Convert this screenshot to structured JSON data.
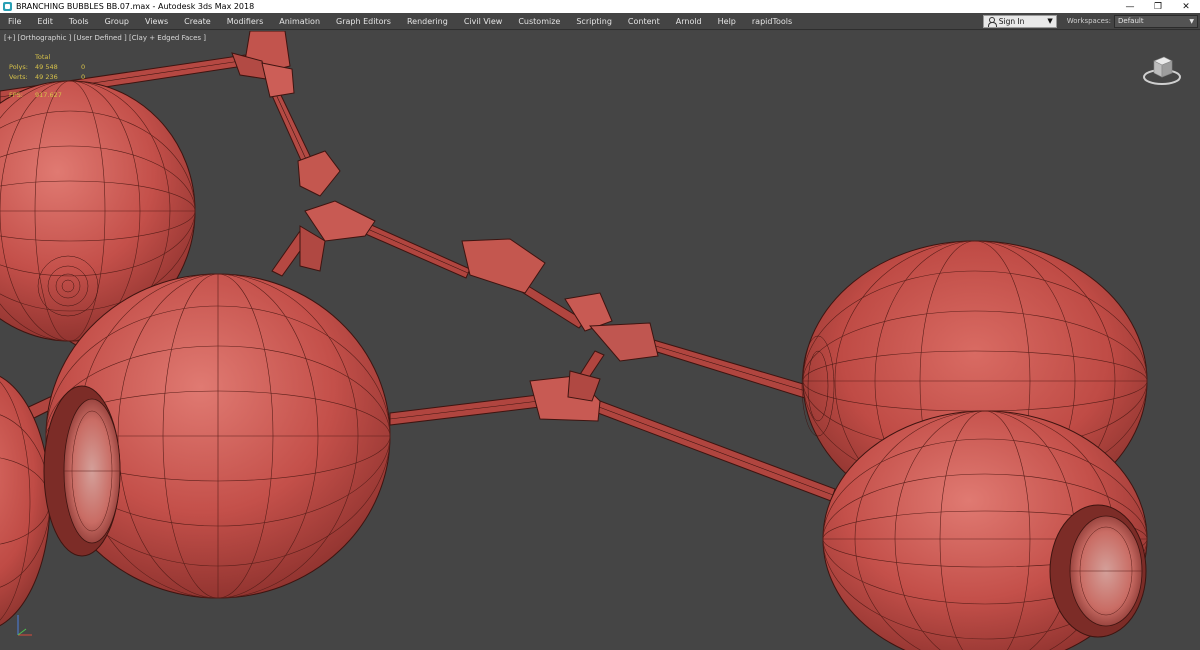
{
  "window": {
    "title": "BRANCHING BUBBLES BB.07.max - Autodesk 3ds Max 2018",
    "controls": {
      "minimize": "—",
      "maximize": "❐",
      "close": "✕"
    }
  },
  "menu": {
    "items": [
      "File",
      "Edit",
      "Tools",
      "Group",
      "Views",
      "Create",
      "Modifiers",
      "Animation",
      "Graph Editors",
      "Rendering",
      "Civil View",
      "Customize",
      "Scripting",
      "Content",
      "Arnold",
      "Help",
      "rapidTools"
    ]
  },
  "account": {
    "sign_in_label": "Sign In",
    "workspaces_label": "Workspaces:",
    "workspace_value": "Default"
  },
  "viewport": {
    "label": "[+] [Orthographic ] [User Defined ] [Clay + Edged Faces ]",
    "stats": {
      "header": "Total",
      "rows": [
        {
          "key": "Polys:",
          "value": "49 548",
          "value2": "0"
        },
        {
          "key": "Verts:",
          "value": "49 236",
          "value2": "0"
        }
      ],
      "fps_key": "FPS:",
      "fps_value": "917.627"
    }
  },
  "icons": [
    "app-icon",
    "user-icon",
    "chevron-down-icon",
    "viewcube-icon",
    "axis-tripod-icon",
    "minimize-icon",
    "maximize-icon",
    "close-icon"
  ],
  "colors": {
    "viewport_bg": "#454545",
    "clay": "#c8544c",
    "clay_dark": "#8f3430",
    "wire": "#4a1a16",
    "stats_text": "#d7c24a"
  }
}
